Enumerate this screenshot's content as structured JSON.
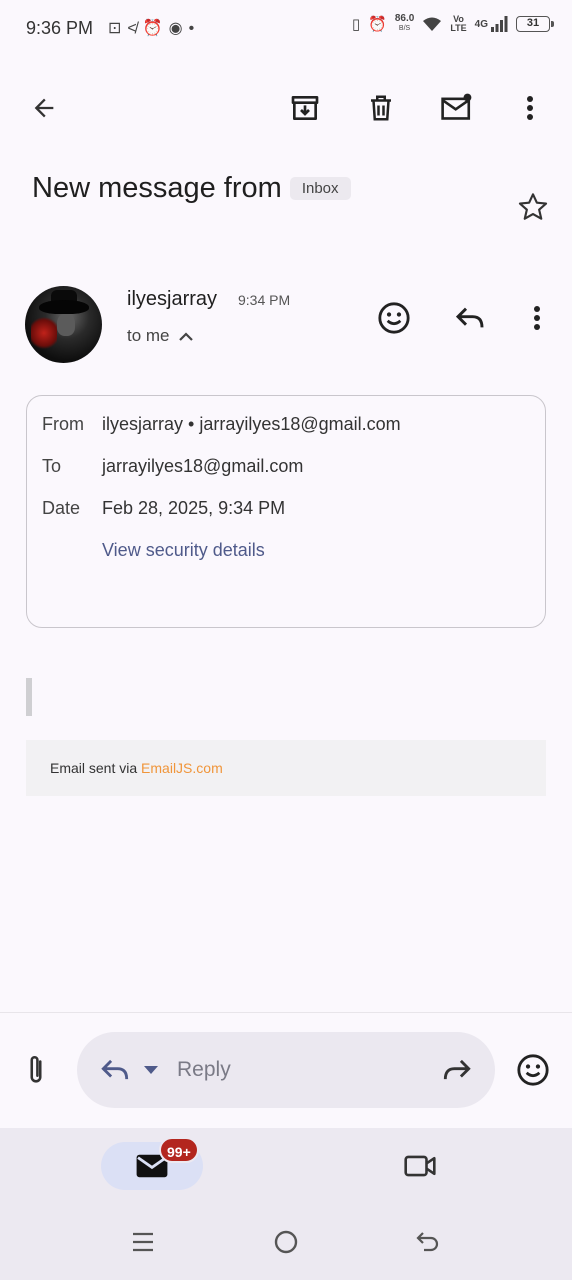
{
  "status_bar": {
    "time": "9:36 PM",
    "net_speed": "86.0",
    "net_unit": "B/S",
    "volte_top": "Vo",
    "volte_bottom": "LTE",
    "network": "4G",
    "battery": "31"
  },
  "email": {
    "subject": "New message from",
    "label": "Inbox",
    "sender_name": "ilyesjarray",
    "time": "9:34 PM",
    "to_summary": "to me",
    "details": {
      "from_label": "From",
      "from_value": "ilyesjarray • jarrayilyes18@gmail.com",
      "to_label": "To",
      "to_value": "jarrayilyes18@gmail.com",
      "date_label": "Date",
      "date_value": "Feb 28, 2025, 9:34 PM",
      "security_link": "View security details"
    },
    "footer_prefix": "Email sent via ",
    "footer_brand": "EmailJS.com"
  },
  "reply_bar": {
    "placeholder": "Reply"
  },
  "bottom_nav": {
    "mail_badge": "99+"
  },
  "icons": {
    "back": "arrow-back-icon",
    "archive": "archive-icon",
    "delete": "trash-icon",
    "unread": "mark-unread-icon",
    "more": "more-vert-icon",
    "star": "star-icon",
    "emoji": "emoji-icon",
    "reply": "reply-icon",
    "attach": "paperclip-icon",
    "forward": "forward-icon",
    "mail": "mail-icon",
    "meet": "video-icon"
  },
  "colors": {
    "background": "#fbf8fd",
    "badge": "#b3261e",
    "link": "#4f5a8a",
    "brand": "#f0953a"
  }
}
